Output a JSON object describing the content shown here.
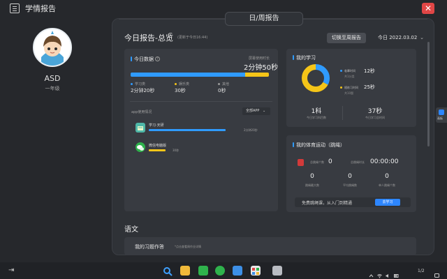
{
  "window": {
    "title": "学情报告",
    "close_glyph": "✕"
  },
  "profile": {
    "name": "ASD",
    "grade": "一年级"
  },
  "panel": {
    "tab_label": "日/周报告",
    "report_title": "今日报告-总览",
    "refresh_glyph": "C",
    "update_text": "(更新于今日16:44)",
    "switch_label": "切换至周报告",
    "date_label": "今日 2022.03.02",
    "date_chevron": "⌄"
  },
  "today": {
    "title": "今日数据",
    "help_glyph": "?",
    "screen_label": "屏幕使用时长",
    "screen_time": "2分钟50秒",
    "progress": [
      {
        "key": "study",
        "fraction": 0.83,
        "color": "#2f9bff"
      },
      {
        "key": "entertainment",
        "fraction": 0.17,
        "color": "#f5c518"
      }
    ],
    "legend": [
      {
        "label": "学习类",
        "value": "2分钟20秒",
        "color": "#2f9bff"
      },
      {
        "label": "娱乐类",
        "value": "30秒",
        "color": "#f5c518"
      },
      {
        "label": "其他",
        "value": "0秒",
        "color": "#9a9a9a"
      }
    ],
    "app_usage_label": "app使用情况",
    "all_app_label": "全部APP",
    "all_app_chevron": "⌄",
    "apps": [
      {
        "name": "学习·天研",
        "time": "2分钟20秒",
        "fraction": 0.82,
        "color": "#2f9bff"
      },
      {
        "name": "微信电脑版",
        "time": "30秒",
        "fraction": 0.18,
        "color": "#f5c518"
      }
    ]
  },
  "study": {
    "title": "我的学习",
    "donut": [
      {
        "fraction": 0.33,
        "color": "#2f9bff"
      },
      {
        "fraction": 0.67,
        "color": "#f5c518"
      }
    ],
    "items": [
      {
        "label": "临摹时间",
        "value": "12秒",
        "sub": "共1分类",
        "color": "#2f9bff"
      },
      {
        "label": "随练习时间",
        "value": "25秒",
        "sub": "共10题",
        "color": "#f5c518"
      }
    ],
    "stats": [
      {
        "value": "1科",
        "label": "今日学习科目数"
      },
      {
        "value": "37秒",
        "label": "今日学习总时间"
      }
    ]
  },
  "sports": {
    "title": "我的体育运动（跳绳）",
    "jump_count_label": "总跳绳个数",
    "jump_count": "0",
    "jump_time_label": "总跳绳时长",
    "jump_time": "00:00:00",
    "stats": [
      {
        "value": "0",
        "label": "跳绳最大数"
      },
      {
        "value": "0",
        "label": "平均跳绳数"
      },
      {
        "value": "0",
        "label": "单人跳绳个数"
      }
    ],
    "free_text": "免费跳绳课，从入门到精通",
    "go_label": "去学习"
  },
  "section": {
    "title": "语文",
    "homework_title": "我的习题作答",
    "homework_sub": "*点击查看周作业详情"
  },
  "side_dock": {
    "label": "画板"
  },
  "taskbar": {
    "tray_text": "1/2"
  }
}
